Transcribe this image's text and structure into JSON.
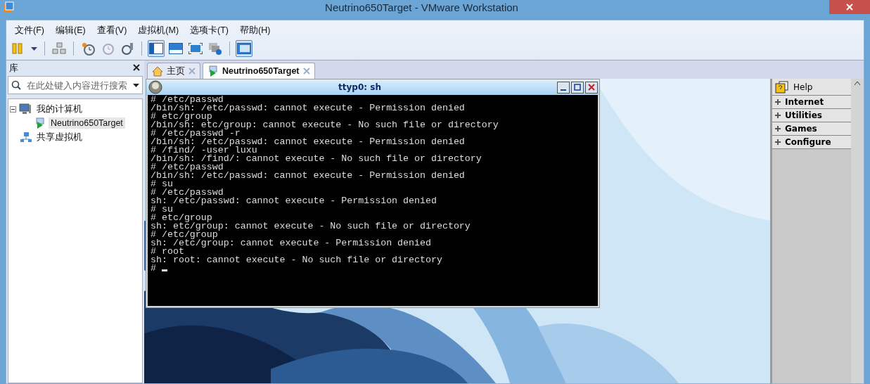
{
  "window": {
    "title": "Neutrino650Target - VMware Workstation"
  },
  "menu": [
    "文件(F)",
    "编辑(E)",
    "查看(V)",
    "虚拟机(M)",
    "选项卡(T)",
    "帮助(H)"
  ],
  "toolbar": [
    {
      "kind": "pause",
      "selected": false
    },
    {
      "kind": "caret",
      "selected": false
    },
    {
      "kind": "sep"
    },
    {
      "kind": "network",
      "selected": false
    },
    {
      "kind": "sep"
    },
    {
      "kind": "snapshot",
      "selected": false
    },
    {
      "kind": "revert",
      "selected": false
    },
    {
      "kind": "manager",
      "selected": false
    },
    {
      "kind": "sep"
    },
    {
      "kind": "sidebar",
      "selected": true
    },
    {
      "kind": "console",
      "selected": false
    },
    {
      "kind": "fullscreen",
      "selected": false
    },
    {
      "kind": "unity",
      "selected": false
    },
    {
      "kind": "sep"
    },
    {
      "kind": "thumbnail",
      "selected": true
    }
  ],
  "library": {
    "title": "库",
    "search": {
      "placeholder": "在此处键入内容进行搜索"
    },
    "tree": [
      {
        "label": "我的计算机",
        "kind": "computer",
        "expanded": true,
        "selected": false,
        "children": [
          {
            "label": "Neutrino650Target",
            "kind": "vm",
            "selected": true
          }
        ]
      },
      {
        "label": "共享虚拟机",
        "kind": "shared",
        "selected": false
      }
    ]
  },
  "tabs": [
    {
      "label": "主页",
      "kind": "home",
      "selected": false
    },
    {
      "label": "Neutrino650Target",
      "kind": "vm",
      "selected": true
    }
  ],
  "terminal": {
    "title": "ttyp0: sh",
    "lines": [
      "# /etc/passwd",
      "/bin/sh: /etc/passwd: cannot execute - Permission denied",
      "# etc/group",
      "/bin/sh: etc/group: cannot execute - No such file or directory",
      "# /etc/passwd -r",
      "/bin/sh: /etc/passwd: cannot execute - Permission denied",
      "# /find/ -user luxu",
      "/bin/sh: /find/: cannot execute - No such file or directory",
      "# /etc/passwd",
      "/bin/sh: /etc/passwd: cannot execute - Permission denied",
      "# su",
      "# /etc/passwd",
      "sh: /etc/passwd: cannot execute - Permission denied",
      "# su",
      "# etc/group",
      "sh: etc/group: cannot execute - No such file or directory",
      "# /etc/group",
      "sh: /etc/group: cannot execute - Permission denied",
      "# root",
      "sh: root: cannot execute - No such file or directory"
    ],
    "prompt": "#"
  },
  "shelf": [
    {
      "label": "Help",
      "kind": "help"
    },
    {
      "label": "Internet",
      "kind": "group",
      "expanded": false
    },
    {
      "label": "Utilities",
      "kind": "group",
      "expanded": false
    },
    {
      "label": "Games",
      "kind": "group",
      "expanded": false
    },
    {
      "label": "Configure",
      "kind": "group",
      "expanded": false
    }
  ]
}
